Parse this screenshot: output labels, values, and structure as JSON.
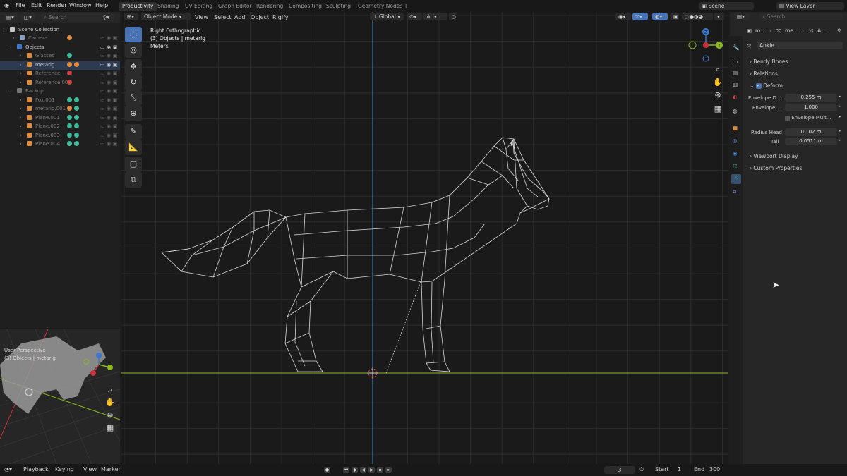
{
  "menus": [
    "File",
    "Edit",
    "Render",
    "Window",
    "Help"
  ],
  "workspaces": [
    "Productivity",
    "Shading",
    "UV Editing",
    "Graph Editor",
    "Rendering",
    "Compositing",
    "Sculpting",
    "Geometry Nodes"
  ],
  "add_tab": "+",
  "scene": "Scene",
  "view_layer": "View Layer",
  "outliner": {
    "search_placeholder": "Search",
    "rows": [
      {
        "label": "Scene Collection",
        "dim": false
      },
      {
        "label": "Camera",
        "dim": true
      },
      {
        "label": "Objects",
        "dim": false
      },
      {
        "label": "Glasses",
        "dim": true
      },
      {
        "label": "metarig",
        "dim": false
      },
      {
        "label": "Reference",
        "dim": true
      },
      {
        "label": "Reference.001",
        "dim": true
      },
      {
        "label": "Backup",
        "dim": true
      },
      {
        "label": "Fox.001",
        "dim": true
      },
      {
        "label": "metarig.001",
        "dim": true
      },
      {
        "label": "Plane.001",
        "dim": true
      },
      {
        "label": "Plane.002",
        "dim": true
      },
      {
        "label": "Plane.003",
        "dim": true
      },
      {
        "label": "Plane.004",
        "dim": true
      }
    ]
  },
  "mini_view": {
    "title": "User Perspective",
    "subtitle": "(3) Objects | metarig"
  },
  "viewport": {
    "mode": "Object Mode",
    "menus": [
      "View",
      "Select",
      "Add",
      "Object",
      "Rigify"
    ],
    "orientation": "Global",
    "title": "Right Orthographic",
    "subtitle": "(3) Objects | metarig",
    "units": "Meters",
    "axes": {
      "z": "Z",
      "y": "Y",
      "neg_y": "-Y"
    }
  },
  "properties": {
    "search_placeholder": "Search",
    "breadcrumb": [
      "m...",
      "me...",
      "A..."
    ],
    "bone_name": "Ankle",
    "panels": {
      "bendy": "Bendy Bones",
      "relations": "Relations",
      "deform": "Deform",
      "viewport_display": "Viewport Display",
      "custom_props": "Custom Properties"
    },
    "deform_enabled": true,
    "envelope_distance_label": "Envelope D...",
    "envelope_distance": "0.255 m",
    "envelope_weight_label": "Envelope ...",
    "envelope_weight": "1.000",
    "envelope_mult": "Envelope Mult...",
    "radius_head_label": "Radius Head",
    "radius_head": "0.102 m",
    "tail_label": "Tail",
    "tail": "0.0511 m"
  },
  "timeline": {
    "menus": [
      "Playback",
      "Keying",
      "View",
      "Marker"
    ],
    "current_frame": "3",
    "start_label": "Start",
    "start": "1",
    "end_label": "End",
    "end": "300"
  },
  "colors": {
    "accent": "#4772b3",
    "x_axis": "#c6313c",
    "y_axis": "#8db81f",
    "z_axis": "#3d77c9",
    "wire": "#d8d8d8"
  }
}
